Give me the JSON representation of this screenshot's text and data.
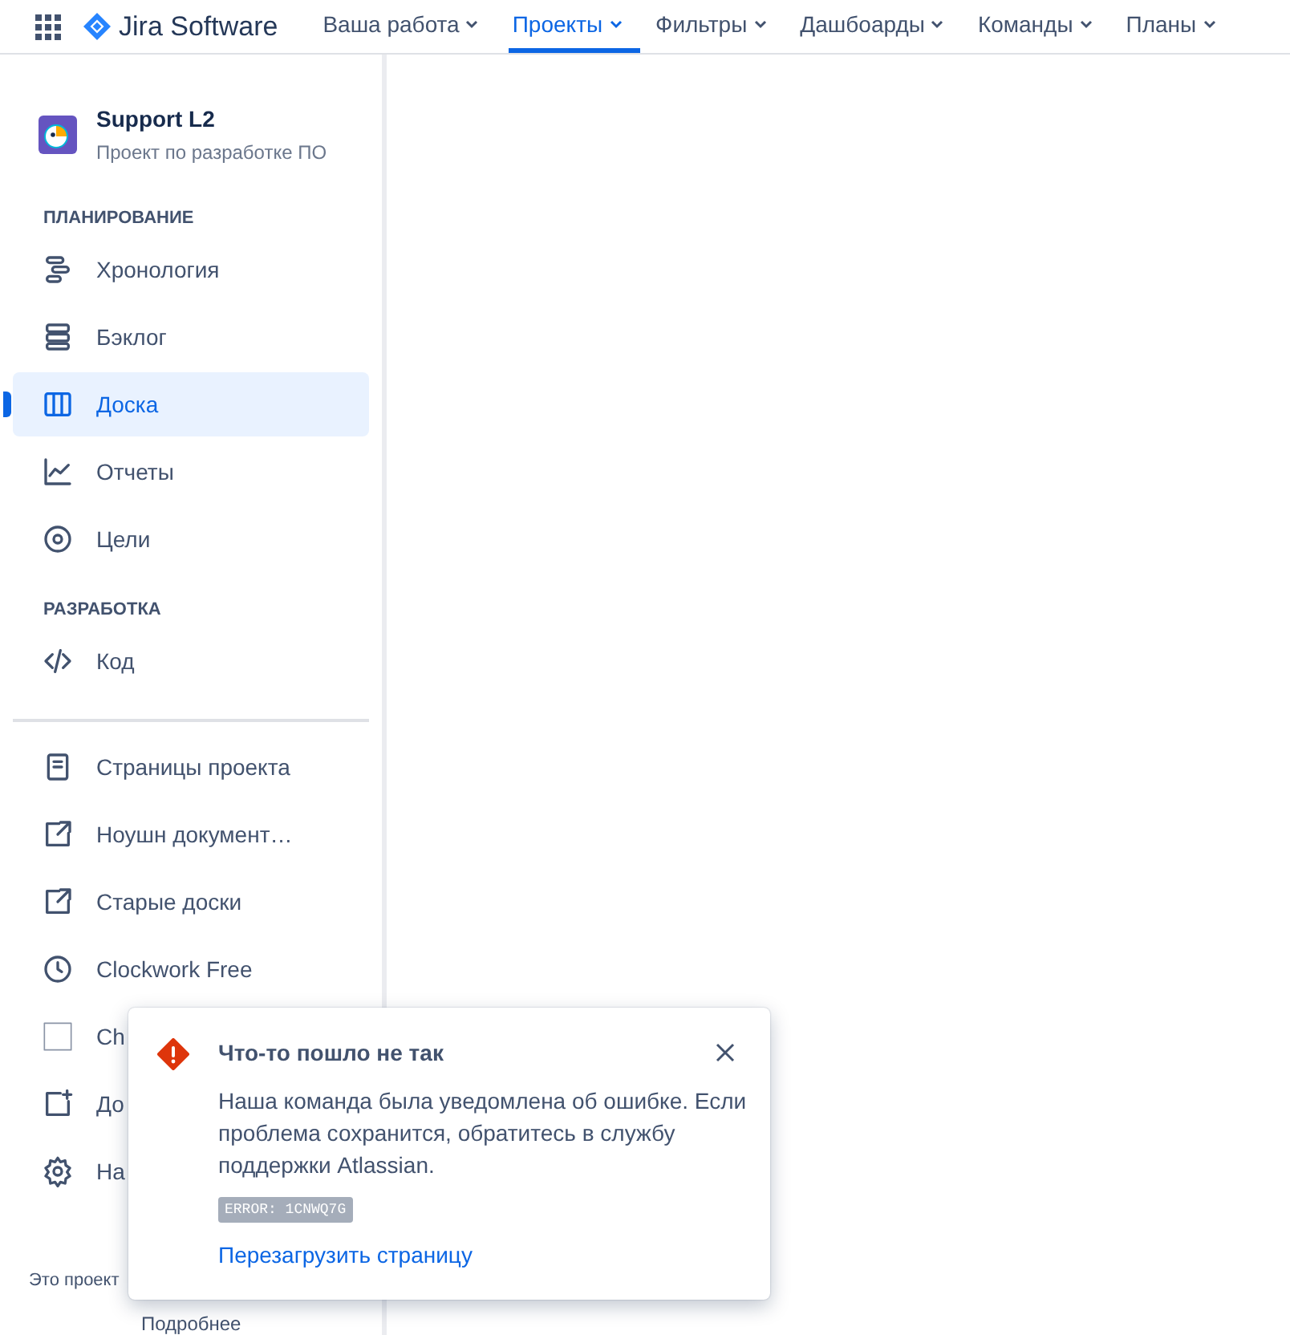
{
  "nav": {
    "product": "Jira Software",
    "items": [
      {
        "label": "Ваша работа",
        "selected": false
      },
      {
        "label": "Проекты",
        "selected": true
      },
      {
        "label": "Фильтры",
        "selected": false
      },
      {
        "label": "Дашбоарды",
        "selected": false
      },
      {
        "label": "Команды",
        "selected": false
      },
      {
        "label": "Планы",
        "selected": false
      }
    ]
  },
  "sidebar": {
    "project": {
      "name": "Support L2",
      "type": "Проект по разработке ПО"
    },
    "groups": [
      {
        "heading": "ПЛАНИРОВАНИЕ",
        "items": [
          {
            "label": "Хронология",
            "selected": false
          },
          {
            "label": "Бэклог",
            "selected": false
          },
          {
            "label": "Доска",
            "selected": true
          },
          {
            "label": "Отчеты",
            "selected": false
          },
          {
            "label": "Цели",
            "selected": false
          }
        ]
      },
      {
        "heading": "РАЗРАБОТКА",
        "items": [
          {
            "label": "Код",
            "selected": false
          }
        ]
      }
    ],
    "links": [
      "Страницы проекта",
      "Ноушн документ…",
      "Старые доски",
      "Clockwork Free",
      "Ch",
      "До",
      "На"
    ],
    "footer": {
      "text": "Это проект",
      "link": "Подробнее"
    }
  },
  "toast": {
    "title": "Что-то пошло не так",
    "message": "Наша команда была уведомлена об ошибке. Если проблема сохранится, обратитесь в службу поддержки Atlassian.",
    "code": "ERROR: 1CNWQ7G",
    "action": "Перезагрузить страницу"
  }
}
